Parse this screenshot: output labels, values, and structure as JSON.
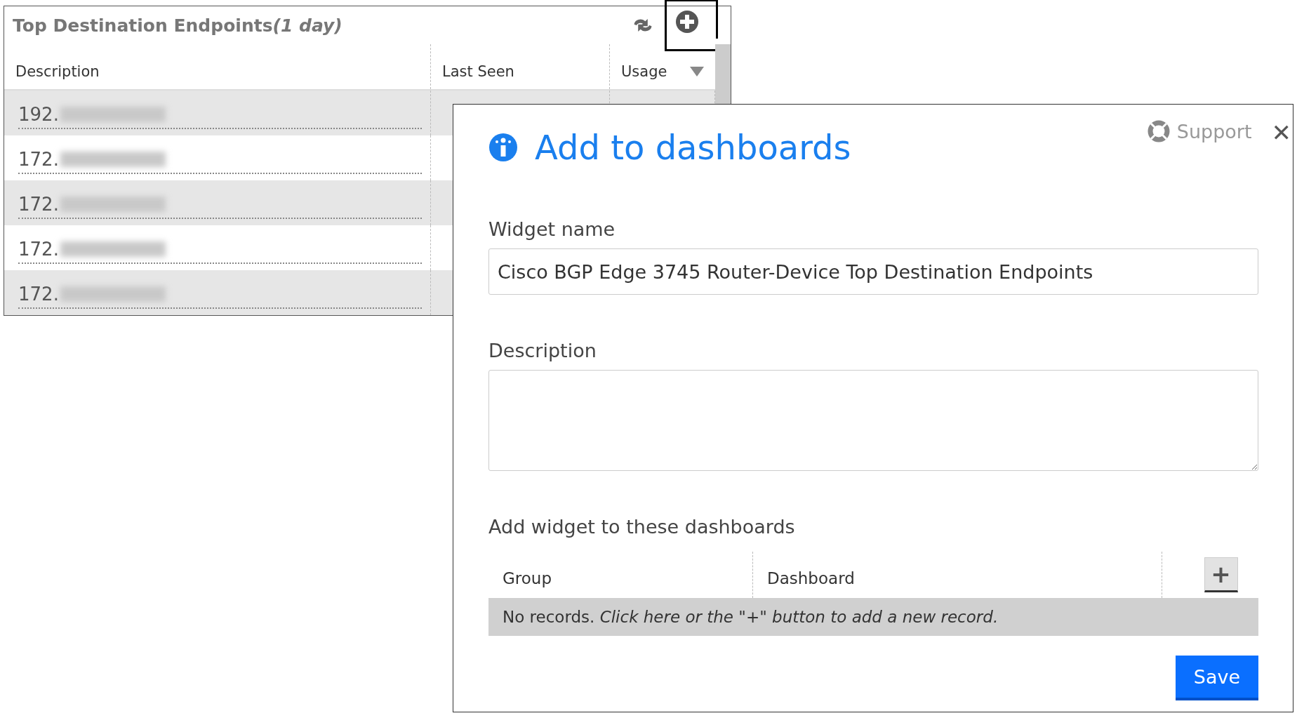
{
  "widget": {
    "title": "Top Destination Endpoints",
    "title_suffix": "(1 day)",
    "columns": [
      {
        "label": "Description",
        "sorted": false
      },
      {
        "label": "Last Seen",
        "sorted": false
      },
      {
        "label": "Usage",
        "sorted": true
      }
    ],
    "rows": [
      {
        "description": "192.",
        "redacted": true,
        "selected": false
      },
      {
        "description": "172.",
        "redacted": true,
        "selected": false
      },
      {
        "description": "172.",
        "redacted": true,
        "selected": false
      },
      {
        "description": "172.",
        "redacted": true,
        "selected": false
      },
      {
        "description": "172.",
        "redacted": true,
        "selected": false
      }
    ],
    "add_highlighted": true
  },
  "dialog": {
    "title": "Add to dashboards",
    "support": "Support",
    "close": "✕",
    "widget_name_label": "Widget name",
    "widget_name_value": "Cisco BGP Edge 3745 Router-Device Top Destination Endpoints",
    "description_label": "Description",
    "dashboards_label": "Add widget to these dashboards",
    "columns": [
      "Group",
      "Dashboard"
    ],
    "add_button": "+",
    "empty_lead": "No records.",
    "empty_hint": "Click here or the \"+\" button to add a new record.",
    "save": "Save"
  }
}
